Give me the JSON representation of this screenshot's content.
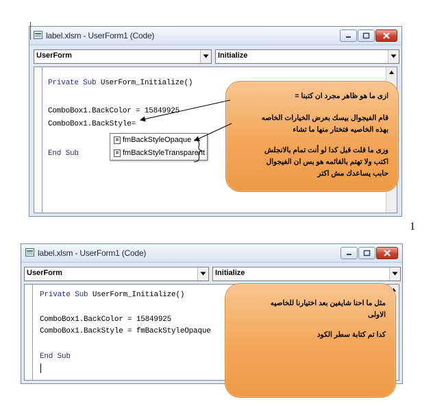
{
  "colors": {
    "accent": "#f2a658",
    "keyword": "#1f2f9a",
    "close": "#c8452e"
  },
  "page_mark": "1",
  "panel1": {
    "title": "label.xlsm - UserForm1 (Code)",
    "object_combo": "UserForm",
    "procedure_combo": "Initialize",
    "code": {
      "sub_keywords": "Private Sub",
      "sub_name": " UserForm_Initialize()",
      "line1": "ComboBox1.BackColor = 15849925",
      "line2": "ComboBox1.BackStyle=",
      "end_sub": "End Sub"
    },
    "autocomplete": [
      "fmBackStyleOpaque",
      "fmBackStyleTransparent"
    ],
    "callout": {
      "line1": "ازى ما هو ظاهر مجرد ان كتبنا =",
      "line2": "قام الفيجوال بيسك بعرض الخيارات الخاصه",
      "line3": "بهذه الخاصيه فتختار منها ما تشاء",
      "line4": "وزى ما قلت قبل كدا لو أنت تمام بالانجلش",
      "line5": "اكتب ولا تهتم بالقائمه هو بس ان الفيجوال",
      "line6": "حابب يساعدك مش اكتر"
    }
  },
  "panel2": {
    "title": "label.xlsm - UserForm1 (Code)",
    "object_combo": "UserForm",
    "procedure_combo": "Initialize",
    "code": {
      "sub_keywords": "Private Sub",
      "sub_name": " UserForm_Initialize()",
      "line1": "ComboBox1.BackColor = 15849925",
      "line2": "ComboBox1.BackStyle = fmBackStyleOpaque",
      "end_sub": "End Sub"
    },
    "callout": {
      "line1": "مثل ما احنا شايفين بعد اختيارنا للخاصيه",
      "line2": "الاولى",
      "line3": "كدا تم كتابة سطر الكود"
    }
  }
}
